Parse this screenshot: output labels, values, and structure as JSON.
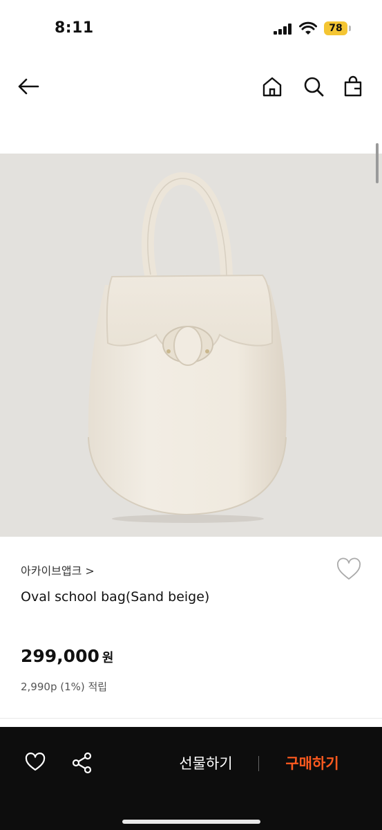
{
  "status_bar": {
    "time": "8:11",
    "battery": "78"
  },
  "nav": {
    "back": "back",
    "home": "home",
    "search": "search",
    "cart": "cart"
  },
  "product": {
    "brand": "아카이브앱크 >",
    "name": "Oval school bag(Sand beige)",
    "price": "299,000",
    "price_unit": "원",
    "points": "2,990p (1%) 적립",
    "image_alt": "Oval school bag in sand beige"
  },
  "bottom_bar": {
    "gift_label": "선물하기",
    "buy_label": "구매하기"
  },
  "colors": {
    "accent": "#ff5a1f",
    "bottom_bar_bg": "#0d0d0d",
    "image_bg": "#e3e1dd",
    "battery": "#f4c533"
  }
}
